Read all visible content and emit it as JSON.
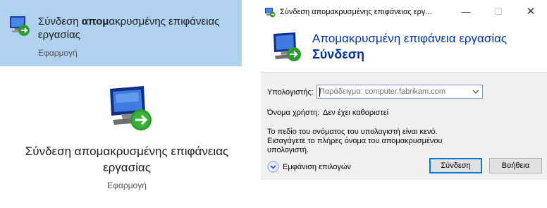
{
  "search_result": {
    "title_prefix": "Σύνδεση ",
    "title_bold": "απομ",
    "title_rest": "ακρυσμένης επιφάνειας εργασίας",
    "subtitle": "Εφαρμογή",
    "icon": "remote-desktop-icon"
  },
  "detail": {
    "title": "Σύνδεση απομακρυσμένης επιφάνειας εργασίας",
    "subtitle": "Εφαρμογή",
    "icon": "remote-desktop-icon"
  },
  "dialog": {
    "window_title": "Σύνδεση απομακρυσμένης επιφάνειας εργ...",
    "window_buttons": {
      "minimize": "—",
      "maximize": "☐",
      "close": "✕"
    },
    "banner_line1": "Απομακρυσμένη επιφάνεια εργασίας",
    "banner_line2": "Σύνδεση",
    "computer_label": "Υπολογιστής:",
    "computer_placeholder": "Παράδειγμα: computer.fabrikam.com",
    "computer_value": "",
    "username_label": "Όνομα χρήστη:",
    "username_value": "Δεν έχει καθοριστεί",
    "message_line1": "Το πεδίο του ονόματος του υπολογιστή είναι κενό.",
    "message_line2": "Εισαγάγετε το πλήρες όνομα του απομακρυσμένου",
    "message_line3": "υπολογιστή.",
    "show_options": "Εμφάνιση επιλογών",
    "connect_button": "Σύνδεση",
    "help_button": "Βοήθεια"
  },
  "colors": {
    "selection": "#b1d2ee",
    "banner_text": "#003399",
    "focus_border": "#0078d7"
  }
}
